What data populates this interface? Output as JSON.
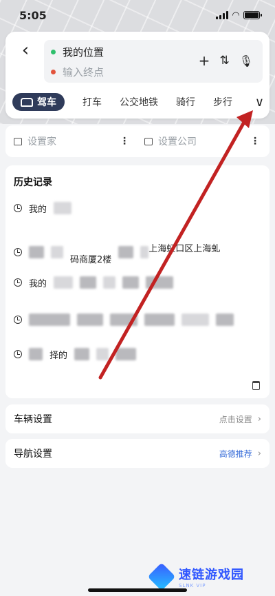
{
  "status_bar": {
    "time": "5:05"
  },
  "search": {
    "start_label": "我的位置",
    "end_placeholder": "输入终点",
    "start_color": "#2ebf6c",
    "end_color": "#e2533c"
  },
  "mode_tabs": [
    {
      "label": "驾车",
      "active": true
    },
    {
      "label": "打车"
    },
    {
      "label": "公交地铁"
    },
    {
      "label": "骑行"
    },
    {
      "label": "步行"
    }
  ],
  "quick_addresses": {
    "home_label": "设置家",
    "company_label": "设置公司"
  },
  "history": {
    "title": "历史记录",
    "items": [
      {
        "text_a": "我的"
      },
      {
        "text_a": "码商厦2楼",
        "text_b": "上海虹口区上海虬"
      },
      {
        "text_a": "我的"
      },
      {
        "text_a": ""
      },
      {
        "text_a": "择的"
      }
    ]
  },
  "settings": {
    "vehicle_label": "车辆设置",
    "vehicle_value": "点击设置",
    "nav_label": "导航设置",
    "nav_value": "高德推荐",
    "accent_color": "#3b6fd9"
  },
  "watermark": {
    "main": "速链游戏园",
    "sub": "SLNK VIP"
  },
  "colors": {
    "tab_active_bg": "#2f3b5a",
    "annotation": "#c22222"
  }
}
